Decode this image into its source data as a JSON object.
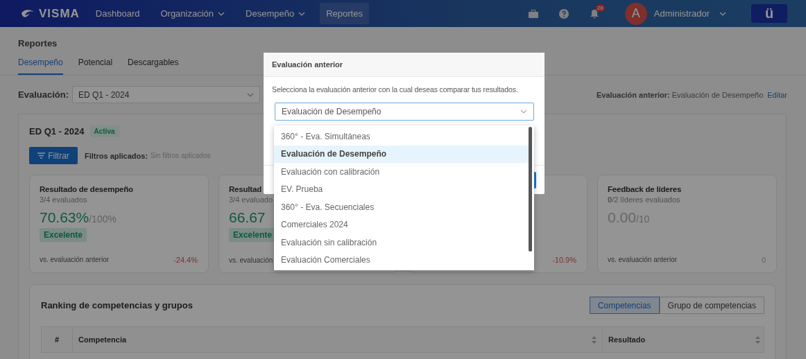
{
  "nav": {
    "logo": "VISMA",
    "items": [
      {
        "label": "Dashboard",
        "dropdown": false,
        "selected": false
      },
      {
        "label": "Organización",
        "dropdown": true,
        "selected": false
      },
      {
        "label": "Desempeño",
        "dropdown": true,
        "selected": false
      },
      {
        "label": "Reportes",
        "dropdown": false,
        "selected": true
      }
    ],
    "notifications": "28",
    "avatar": "A",
    "user": "Administrador",
    "app_button": "ü"
  },
  "page": {
    "title": "Reportes",
    "tabs": [
      {
        "label": "Desempeño",
        "selected": true
      },
      {
        "label": "Potencial",
        "selected": false
      },
      {
        "label": "Descargables",
        "selected": false
      }
    ],
    "evaluation_label": "Evaluación:",
    "evaluation_value": "ED Q1 - 2024",
    "previous": "**Evaluación anterior:** Evaluación de Desempeño",
    "edit_link": "Editar"
  },
  "summary": {
    "title": "ED Q1 - 2024",
    "status": "Activa",
    "filter_button": "Filtrar",
    "filters_label": "Filtros aplicados:",
    "filters_value": "Sin filtros aplicados"
  },
  "cards": [
    {
      "title": "Resultado de desempeño",
      "subtitle": "3/4 evaluados",
      "score": "70.63%",
      "scale": "/100%",
      "score_highlighted": true,
      "rating": "Excelente",
      "comparison": "vs. evaluación anterior",
      "delta": "-24.4%",
      "negative": true
    },
    {
      "title": "Resultad",
      "subtitle": "3/4 evaluado",
      "score": "66.67",
      "score_highlighted": true,
      "rating": "Excelente",
      "comparison": "vs. evaluación"
    },
    {
      "delta": "-10.9%",
      "negative": true
    },
    {
      "title": "Feedback de líderes",
      "subtitle": "**0**/2 líderes evaluados",
      "score": "0.00",
      "scale": "/10",
      "score_highlighted": false,
      "comparison": "vs. evaluación anterior",
      "delta": "0",
      "negative": false
    }
  ],
  "ranking": {
    "title": "Ranking de competencias y grupos",
    "toggle": [
      {
        "label": "Competencias",
        "selected": true
      },
      {
        "label": "Grupo de competencias",
        "selected": false
      }
    ],
    "columns": [
      {
        "label": "#",
        "sortable": false
      },
      {
        "label": "Competencia",
        "sortable": true
      },
      {
        "label": "Resultado",
        "sortable": true
      }
    ]
  },
  "modal": {
    "title": "Evaluación anterior",
    "text": "Selecciona la evaluación anterior con la cual deseas comparar tus resultados.",
    "select_value": "Evaluación de Desempeño",
    "options": [
      {
        "label": "360° - Eva. Simultáneas",
        "selected": false
      },
      {
        "label": "Evaluación de Desempeño",
        "selected": true
      },
      {
        "label": "Evaluación con calibración",
        "selected": false
      },
      {
        "label": "EV. Prueba",
        "selected": false
      },
      {
        "label": "360° - Eva. Secuenciales",
        "selected": false
      },
      {
        "label": "Comerciales 2024",
        "selected": false
      },
      {
        "label": "Evaluación sin calibración",
        "selected": false
      },
      {
        "label": "Evaluación Comerciales",
        "selected": false
      }
    ]
  }
}
